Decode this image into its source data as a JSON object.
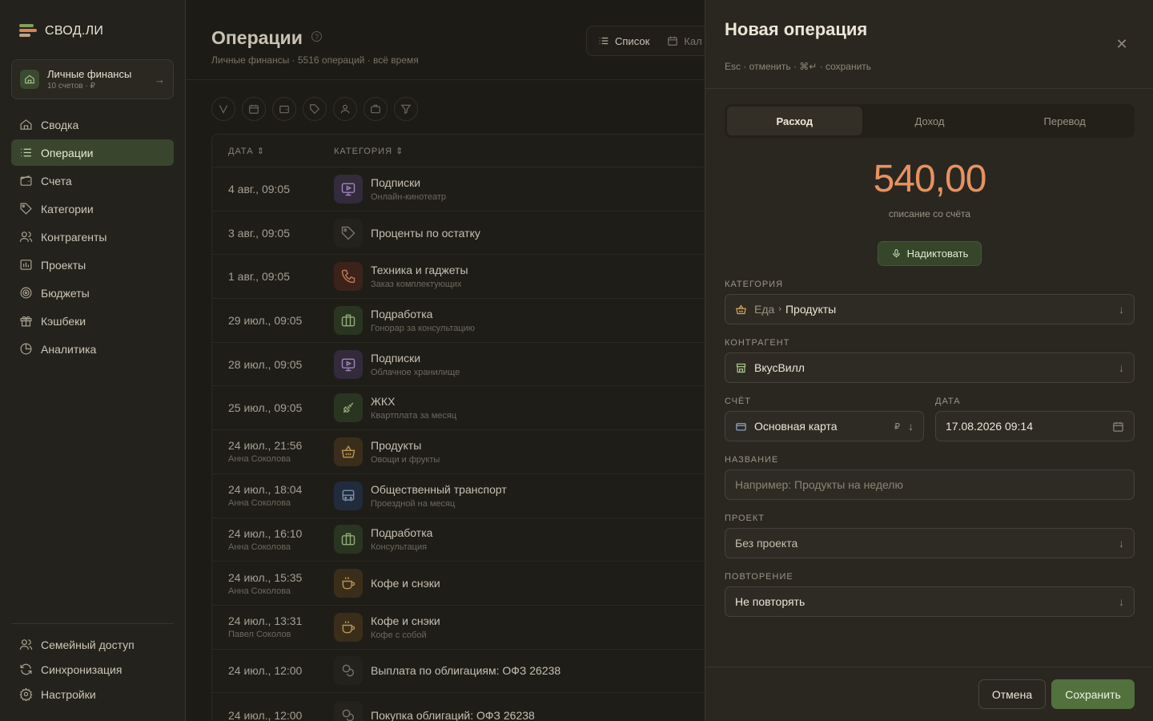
{
  "brand": {
    "name": "СВОД.ЛИ"
  },
  "workspace": {
    "title": "Личные финансы",
    "subtitle": "10 счетов · ₽"
  },
  "nav": [
    {
      "label": "Сводка",
      "icon": "home-icon"
    },
    {
      "label": "Операции",
      "icon": "list-icon",
      "active": true
    },
    {
      "label": "Счета",
      "icon": "wallet-icon"
    },
    {
      "label": "Категории",
      "icon": "tag-icon"
    },
    {
      "label": "Контрагенты",
      "icon": "users-icon"
    },
    {
      "label": "Проекты",
      "icon": "projects-icon"
    },
    {
      "label": "Бюджеты",
      "icon": "target-icon"
    },
    {
      "label": "Кэшбеки",
      "icon": "gift-icon"
    },
    {
      "label": "Аналитика",
      "icon": "pie-chart-icon"
    }
  ],
  "nav_bottom": [
    {
      "label": "Семейный доступ",
      "icon": "family-icon"
    },
    {
      "label": "Синхронизация",
      "icon": "sync-icon"
    },
    {
      "label": "Настройки",
      "icon": "gear-icon"
    }
  ],
  "page": {
    "title": "Операции",
    "subtitle": "Личные финансы · 5516 операций · всё время",
    "view_list": "Список",
    "view_calendar": "Кал"
  },
  "table": {
    "col_date": "ДАТА",
    "col_category": "КАТЕГОРИЯ",
    "rows": [
      {
        "date": "4 авг., 09:05",
        "user": "",
        "category": "Подписки",
        "note": "Онлайн-кинотеатр",
        "icon": "monitor-icon",
        "color": "#3b3145"
      },
      {
        "date": "3 авг., 09:05",
        "user": "",
        "category": "Проценты по остатку",
        "note": "",
        "icon": "tag-icon",
        "color": "#2a2720"
      },
      {
        "date": "1 авг., 09:05",
        "user": "",
        "category": "Техника и гаджеты",
        "note": "Заказ комплектующих",
        "icon": "phone-icon",
        "color": "#44281f"
      },
      {
        "date": "29 июл., 09:05",
        "user": "",
        "category": "Подработка",
        "note": "Гонорар за консультацию",
        "icon": "briefcase-icon",
        "color": "#2f3d26"
      },
      {
        "date": "28 июл., 09:05",
        "user": "",
        "category": "Подписки",
        "note": "Облачное хранилище",
        "icon": "monitor-icon",
        "color": "#3b3145"
      },
      {
        "date": "25 июл., 09:05",
        "user": "",
        "category": "ЖКХ",
        "note": "Квартплата за месяц",
        "icon": "plug-icon",
        "color": "#2f3d26"
      },
      {
        "date": "24 июл., 21:56",
        "user": "Анна Соколова",
        "category": "Продукты",
        "note": "Овощи и фрукты",
        "icon": "basket-icon",
        "color": "#42351f"
      },
      {
        "date": "24 июл., 18:04",
        "user": "Анна Соколова",
        "category": "Общественный транспорт",
        "note": "Проездной на месяц",
        "icon": "bus-icon",
        "color": "#263245"
      },
      {
        "date": "24 июл., 16:10",
        "user": "Анна Соколова",
        "category": "Подработка",
        "note": "Консультация",
        "icon": "briefcase-icon",
        "color": "#2f3d26"
      },
      {
        "date": "24 июл., 15:35",
        "user": "Анна Соколова",
        "category": "Кофе и снэки",
        "note": "",
        "icon": "coffee-icon",
        "color": "#42351f"
      },
      {
        "date": "24 июл., 13:31",
        "user": "Павел Соколов",
        "category": "Кофе и снэки",
        "note": "Кофе с собой",
        "icon": "coffee-icon",
        "color": "#42351f"
      },
      {
        "date": "24 июл., 12:00",
        "user": "",
        "category": "Выплата по облигациям: ОФЗ 26238",
        "note": "",
        "icon": "coins-icon",
        "color": "#2a2720"
      },
      {
        "date": "24 июл., 12:00",
        "user": "",
        "category": "Покупка облигаций: ОФЗ 26238",
        "note": "",
        "icon": "coins-icon",
        "color": "#2a2720"
      }
    ]
  },
  "panel": {
    "title": "Новая операция",
    "hint": "Esc · отменить · ⌘↵ · сохранить",
    "tabs": [
      "Расход",
      "Доход",
      "Перевод"
    ],
    "amount": "540,00",
    "amount_sub": "списание со счёта",
    "dictate": "Надиктовать",
    "category_label": "КАТЕГОРИЯ",
    "category_parent": "Еда",
    "category_value": "Продукты",
    "counterparty_label": "КОНТРАГЕНТ",
    "counterparty_value": "ВкусВилл",
    "account_label": "СЧЁТ",
    "account_value": "Основная карта",
    "account_currency": "₽",
    "date_label": "ДАТА",
    "date_value": "17.08.2026 09:14",
    "name_label": "НАЗВАНИЕ",
    "name_placeholder": "Например: Продукты на неделю",
    "project_label": "ПРОЕКТ",
    "project_value": "Без проекта",
    "repeat_label": "ПОВТОРЕНИЕ",
    "repeat_value": "Не повторять",
    "cancel": "Отмена",
    "save": "Сохранить"
  },
  "colors": {
    "accent": "#52713d",
    "amount": "#e7925f",
    "active_nav": "#39452c"
  }
}
